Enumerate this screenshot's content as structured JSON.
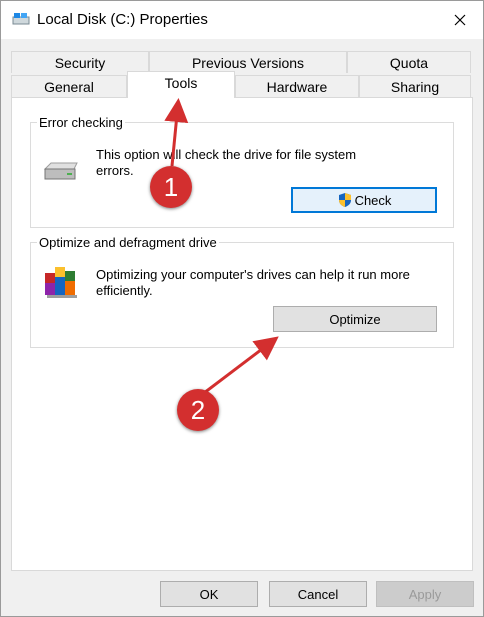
{
  "window": {
    "title": "Local Disk (C:) Properties"
  },
  "tabs_row1": [
    "Security",
    "Previous Versions",
    "Quota"
  ],
  "tabs_row2": [
    "General",
    "Tools",
    "Hardware",
    "Sharing"
  ],
  "active_tab": "Tools",
  "error_checking": {
    "heading": "Error checking",
    "line1": "This option will check the drive for file system",
    "line2": "errors.",
    "button": "Check"
  },
  "optimize": {
    "heading": "Optimize and defragment drive",
    "line1": "Optimizing your computer's drives can help it run more",
    "line2": "efficiently.",
    "button": "Optimize"
  },
  "footer": {
    "ok": "OK",
    "cancel": "Cancel",
    "apply": "Apply"
  },
  "annotations": [
    "1",
    "2"
  ],
  "colors": {
    "accent": "#0078d7",
    "annotation": "#d32f2f"
  }
}
